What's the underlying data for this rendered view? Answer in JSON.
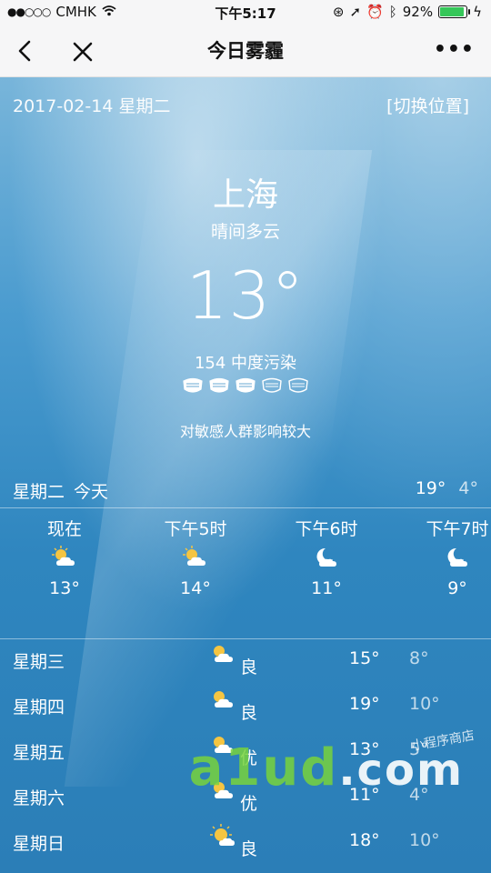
{
  "status": {
    "carrier": "CMHK",
    "time": "下午5:17",
    "battery": "92%",
    "battery_level": 0.92
  },
  "nav": {
    "title": "今日雾霾",
    "back_icon": "chevron-left-icon",
    "close_icon": "close-icon",
    "more_label": "•••"
  },
  "header": {
    "date": "2017-02-14 星期二",
    "switch_location": "[切换位置]"
  },
  "current": {
    "city": "上海",
    "condition": "晴间多云",
    "temperature": "13°",
    "aqi": "154 中度污染",
    "mask_count": 5,
    "advice": "对敏感人群影响较大"
  },
  "today": {
    "day": "星期二",
    "label": "今天",
    "high": "19°",
    "low": "4°"
  },
  "hourly": [
    {
      "time": "现在",
      "temp": "13°",
      "icon": "sun-cloud-icon"
    },
    {
      "time": "下午5时",
      "temp": "14°",
      "icon": "sun-cloud-icon"
    },
    {
      "time": "下午6时",
      "temp": "11°",
      "icon": "moon-cloud-icon"
    },
    {
      "time": "下午7时",
      "temp": "9°",
      "icon": "moon-cloud-icon"
    }
  ],
  "daily": [
    {
      "day": "星期三",
      "air": "良",
      "high": "15°",
      "low": "8°",
      "icon": "sun-cloud-icon"
    },
    {
      "day": "星期四",
      "air": "良",
      "high": "19°",
      "low": "10°",
      "icon": "sun-cloud-icon"
    },
    {
      "day": "星期五",
      "air": "优",
      "high": "13°",
      "low": "5°",
      "icon": "sun-cloud-icon"
    },
    {
      "day": "星期六",
      "air": "优",
      "high": "11°",
      "low": "4°",
      "icon": "sun-cloud-icon"
    },
    {
      "day": "星期日",
      "air": "良",
      "high": "18°",
      "low": "10°",
      "icon": "sun-cloud-icon"
    }
  ],
  "watermark": {
    "text": "a1ud",
    "suffix": ".com",
    "caption": "小程序商店"
  },
  "colors": {
    "sky_top": "#78b5da",
    "sky_bottom": "#2b7eb7",
    "sun": "#f5c542",
    "text": "#ffffff"
  }
}
